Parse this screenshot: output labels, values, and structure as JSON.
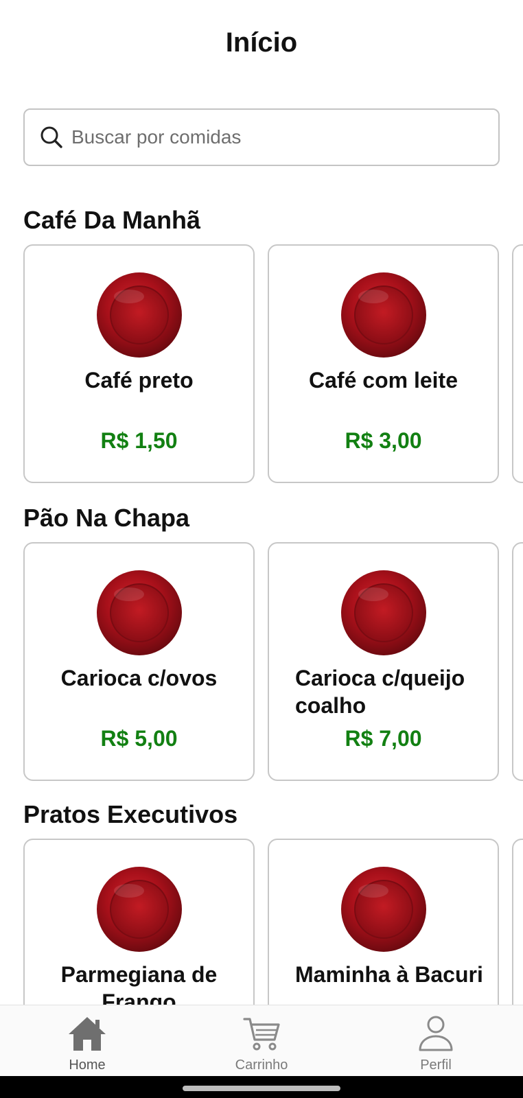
{
  "header": {
    "title": "Início"
  },
  "search": {
    "placeholder": "Buscar por comidas"
  },
  "sections": [
    {
      "title": "Café Da Manhã",
      "items": [
        {
          "name": "Café preto",
          "price": "R$ 1,50"
        },
        {
          "name": "Café com leite",
          "price": "R$ 3,00"
        }
      ]
    },
    {
      "title": "Pão Na Chapa",
      "items": [
        {
          "name": "Carioca c/ovos",
          "price": "R$ 5,00"
        },
        {
          "name": "Carioca c/queijo coalho",
          "price": "R$ 7,00"
        }
      ]
    },
    {
      "title": "Pratos Executivos",
      "items": [
        {
          "name": "Parmegiana de Frango",
          "price": ""
        },
        {
          "name": "Maminha à Bacuri",
          "price": ""
        }
      ]
    }
  ],
  "bottom_nav": {
    "items": [
      {
        "label": "Home",
        "icon": "home-icon",
        "active": true
      },
      {
        "label": "Carrinho",
        "icon": "cart-icon",
        "active": false
      },
      {
        "label": "Perfil",
        "icon": "user-icon",
        "active": false
      }
    ]
  },
  "colors": {
    "price": "#128012",
    "plate": "#b0151c",
    "nav_active": "#6f6f6f",
    "nav_inactive": "#8a8a8a"
  }
}
